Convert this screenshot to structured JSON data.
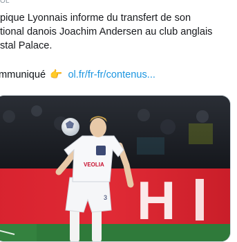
{
  "tweet": {
    "handle_fragment": "OL",
    "text_lines": [
      "pique Lyonnais informe du transfert de son",
      "tional danois Joachim Andersen au club anglais",
      "stal Palace."
    ],
    "communique_label": "mmuniqué",
    "communique_emoji": "👉",
    "link_text": "ol.fr/fr-fr/contenus..."
  },
  "photo": {
    "shirt_sponsor": "VEOLIA",
    "shirt_number": "3",
    "board_text": "H"
  },
  "colors": {
    "link": "#1b95e0",
    "board_red": "#d8232f",
    "pitch_green": "#2f7a3a"
  }
}
